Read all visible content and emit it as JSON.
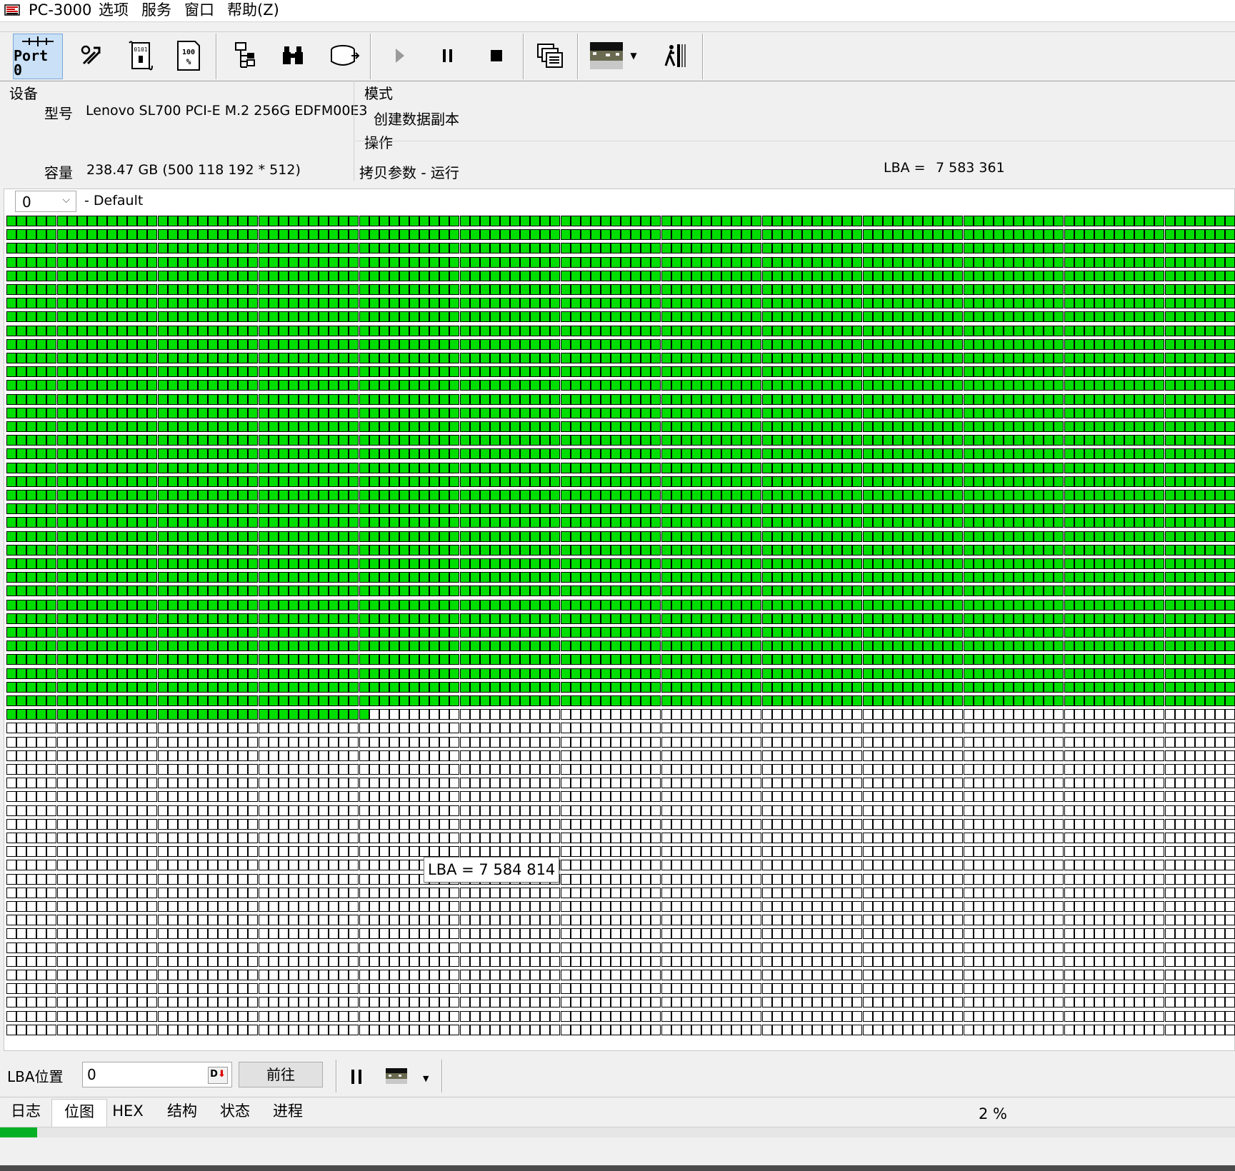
{
  "menu": {
    "app_title": "PC-3000",
    "items": [
      "选项",
      "服务",
      "窗口",
      "帮助(Z)"
    ]
  },
  "toolbar": {
    "port_label": "Port 0",
    "buttons": [
      "port-icon",
      "tools-icon",
      "script-icon",
      "percent-icon",
      "tree-icon",
      "binoculars-icon",
      "disk-icon",
      "play-icon",
      "pause-icon",
      "stop-icon",
      "copy-windows-icon",
      "preview-image-icon",
      "exit-icon"
    ]
  },
  "device": {
    "section_title": "设备",
    "model_label": "型号",
    "model_value": "Lenovo  SL700 PCI-E M.2 256G EDFM00E3",
    "capacity_label": "容量",
    "capacity_value": "238.47 GB (500 118 192 * 512)"
  },
  "mode": {
    "section_title": "模式",
    "value": "创建数据副本"
  },
  "operation": {
    "section_title": "操作",
    "value": "拷贝参数 - 运行",
    "lba_label": "LBA =",
    "lba_value": "7 583 361"
  },
  "map": {
    "combo_value": "0",
    "combo_label": "- Default",
    "done_color": "#00dd00",
    "todo_color": "#ffffff",
    "tooltip": "LBA =  7 584 814",
    "grid": {
      "columns": 122,
      "rows": 60,
      "complete_rows": 36,
      "complete_cells_last_row": 36,
      "completed_fraction": 0.297
    }
  },
  "bottom": {
    "lba_pos_label": "LBA位置",
    "lba_pos_value": "0",
    "goto_label": "前往"
  },
  "tabs": [
    {
      "label": "日志",
      "active": false
    },
    {
      "label": "位图",
      "active": true
    },
    {
      "label": "HEX",
      "active": false
    },
    {
      "label": "结构",
      "active": false
    },
    {
      "label": "状态",
      "active": false
    },
    {
      "label": "进程",
      "active": false
    }
  ],
  "progress": {
    "percent_text": "2 %",
    "value": 0.03,
    "color": "#06b025"
  }
}
